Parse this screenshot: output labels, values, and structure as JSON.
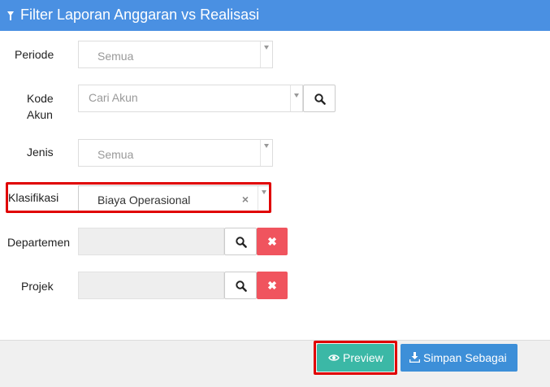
{
  "header": {
    "title": "Filter Laporan Anggaran vs Realisasi",
    "icon": "filter-icon"
  },
  "fields": {
    "periode": {
      "label": "Periode",
      "value": "Semua"
    },
    "kode_akun": {
      "label_line1": "Kode",
      "label_line2": "Akun",
      "placeholder": "Cari Akun"
    },
    "jenis": {
      "label": "Jenis",
      "value": "Semua"
    },
    "klasifikasi": {
      "label": "Klasifikasi",
      "value": "Biaya Operasional",
      "clear": "×"
    },
    "departemen": {
      "label": "Departemen",
      "value": ""
    },
    "projek": {
      "label": "Projek",
      "value": ""
    }
  },
  "buttons": {
    "preview": "Preview",
    "save_as": "Simpan Sebagai",
    "clear_glyph": "✖"
  },
  "colors": {
    "header_bg": "#4a90e2",
    "preview_bg": "#3bb8a6",
    "save_bg": "#3d8fd8",
    "clear_bg": "#f0545e",
    "highlight": "#e00000"
  }
}
